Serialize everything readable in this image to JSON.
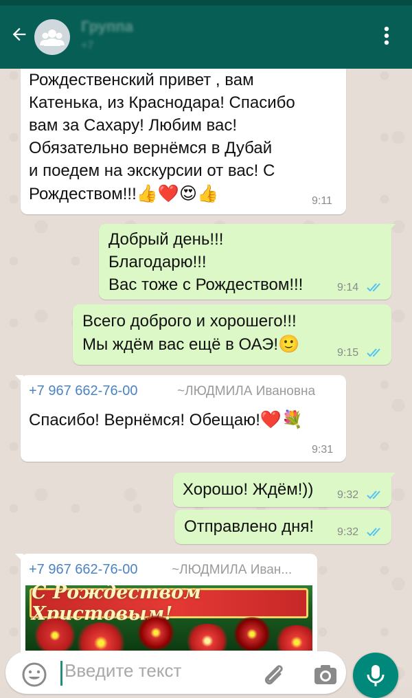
{
  "header": {
    "title": "Группа",
    "subtitle": "+7",
    "back_icon": "arrow-left-icon",
    "avatar_icon": "group-avatar-icon",
    "menu_icon": "more-vert-icon",
    "color": "#075e54"
  },
  "messages": [
    {
      "direction": "in",
      "text": "Рождественский привет , вам\nКатенька, из Краснодара! Спасибо\nвам за Сахару! Любим вас!\nОбязательно вернёмся в Дубай\nи поедем на экскурсии от вас! С\nРождеством!!!",
      "emojis": "👍❤️😍👍",
      "time": "9:11"
    },
    {
      "direction": "out",
      "text": "Добрый день!!!\nБлагодарю!!!\nВас тоже с Рождеством!!!",
      "time": "9:14",
      "status": "read"
    },
    {
      "direction": "out",
      "text": "Всего доброго и хорошего!!!\nМы ждём вас ещё в ОАЭ!",
      "emojis": "🙂",
      "time": "9:15",
      "status": "read"
    },
    {
      "direction": "in",
      "sender": "+7 967 662-76-00",
      "nickname": "~ЛЮДМИЛА Ивановна",
      "text": "Спасибо! Вернёмся! Обещаю!",
      "emojis": "❤️💐",
      "time": "9:31"
    },
    {
      "direction": "out",
      "text": "Хорошо! Ждём!))",
      "time": "9:32",
      "status": "read"
    },
    {
      "direction": "out",
      "text": "Отправлено дня!",
      "time": "9:32",
      "status": "read"
    },
    {
      "direction": "in",
      "sender": "+7 967 662-76-00",
      "nickname": "~ЛЮДМИЛА Иван...",
      "image_banner_text": "С Рождеством Христовым!"
    }
  ],
  "composer": {
    "placeholder": "Введите текст",
    "emoji_icon": "emoji-smiley-icon",
    "attach_icon": "paperclip-icon",
    "camera_icon": "camera-icon",
    "mic_icon": "microphone-icon",
    "mic_color": "#00897b"
  },
  "colors": {
    "incoming_bubble": "#ffffff",
    "outgoing_bubble": "#dcf8c6",
    "read_ticks": "#4fc3f7",
    "sender_name": "#4a83c4"
  }
}
